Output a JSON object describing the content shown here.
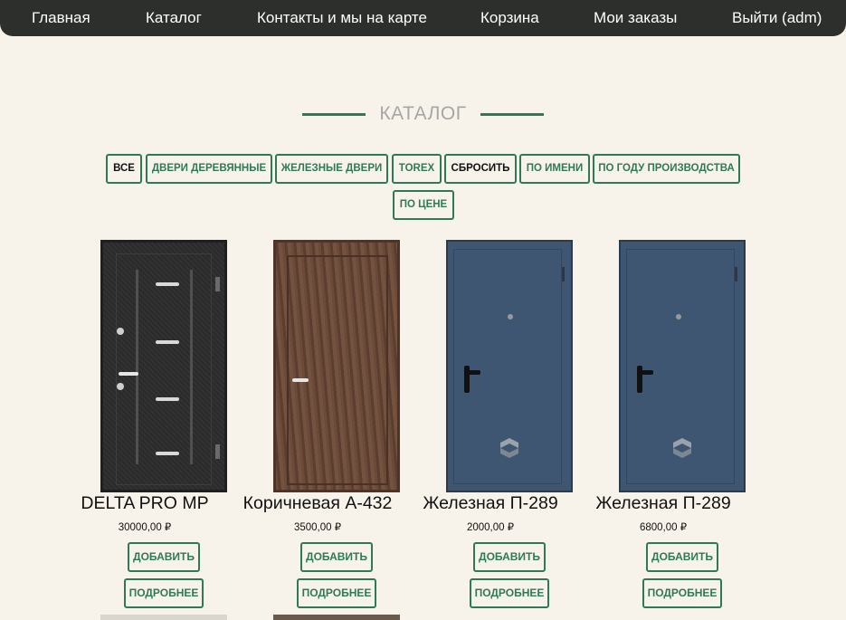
{
  "nav": {
    "items": [
      {
        "label": "Главная"
      },
      {
        "label": "Каталог"
      },
      {
        "label": "Контакты и мы на карте"
      },
      {
        "label": "Корзина"
      },
      {
        "label": "Мои заказы"
      },
      {
        "label": "Выйти (adm)"
      }
    ]
  },
  "catalog": {
    "title": "КАТАЛОГ",
    "filters": [
      {
        "label": "ВСЕ"
      },
      {
        "label": "ДВЕРИ ДЕРЕВЯННЫЕ"
      },
      {
        "label": "ЖЕЛЕЗНЫЕ ДВЕРИ"
      },
      {
        "label": "TOREX"
      },
      {
        "label": "СБРОСИТЬ"
      },
      {
        "label": "ПО ИМЕНИ"
      },
      {
        "label": "ПО ГОДУ ПРОИЗВОДСТВА"
      },
      {
        "label": "ПО ЦЕНЕ"
      }
    ]
  },
  "products": [
    {
      "name": "DELTA PRO MP",
      "price": "30000,00 ₽",
      "add_label": "ДОБАВИТЬ",
      "details_label": "ПОДРОБНЕЕ"
    },
    {
      "name": "Коричневая А-432",
      "price": "3500,00 ₽",
      "add_label": "ДОБАВИТЬ",
      "details_label": "ПОДРОБНЕЕ"
    },
    {
      "name": "Железная П-289",
      "price": "2000,00 ₽",
      "add_label": "ДОБАВИТЬ",
      "details_label": "ПОДРОБНЕЕ"
    },
    {
      "name": "Железная П-289",
      "price": "6800,00 ₽",
      "add_label": "ДОБАВИТЬ",
      "details_label": "ПОДРОБНЕЕ"
    }
  ],
  "colors": {
    "accent": "#2e7a55",
    "background": "#f8f3ea",
    "navbar": "#2d2f2c"
  }
}
